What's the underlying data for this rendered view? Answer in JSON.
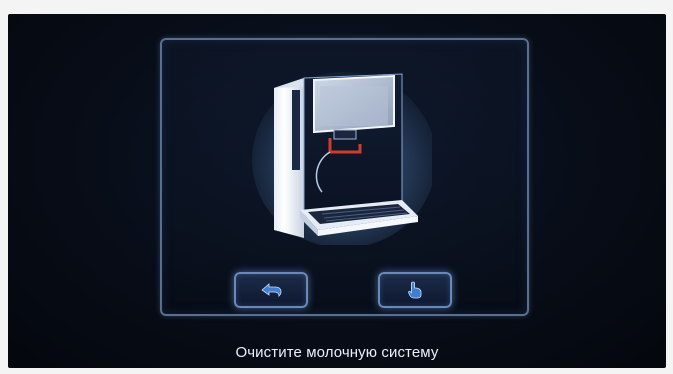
{
  "screen": {
    "message": "Очистите молочную систему"
  },
  "buttons": {
    "back_icon": "return-arrow-icon",
    "confirm_icon": "hand-pointer-icon"
  },
  "colors": {
    "screen_background": "#070c16",
    "panel_border": "#5a6f8e",
    "button_glow": "#6a88b8",
    "icon_blue": "#3e7fd6",
    "spout_red": "#d23a2a",
    "message_text": "#eaf0fa"
  }
}
